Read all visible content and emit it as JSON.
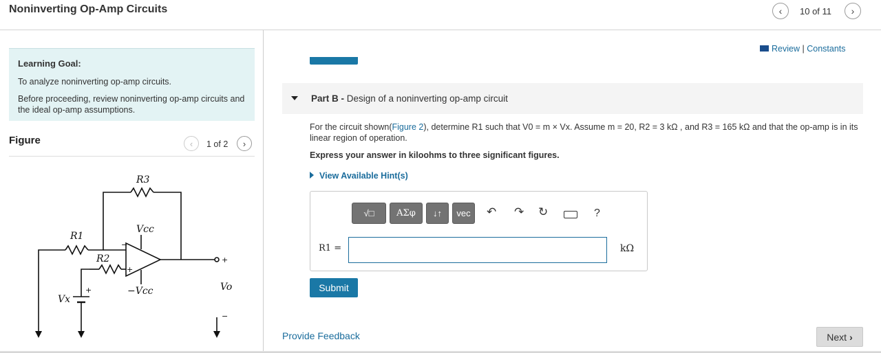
{
  "header": {
    "title": "Noninverting Op-Amp Circuits",
    "page_counter": "10 of 11"
  },
  "learning_goal": {
    "title": "Learning Goal:",
    "line1": "To analyze noninverting op-amp circuits.",
    "line2": "Before proceeding, review noninverting op-amp circuits and the ideal op-amp assumptions."
  },
  "figure": {
    "title": "Figure",
    "pager": "1 of 2",
    "labels": {
      "r3": "R3",
      "r1": "R1",
      "r2": "R2",
      "vcc": "Vcc",
      "neg_vcc": "−Vcc",
      "vo": "Vo",
      "vx": "Vx",
      "plus": "+",
      "minus": "−"
    }
  },
  "review": {
    "review_label": "Review",
    "separator": "|",
    "constants_label": "Constants"
  },
  "part_b": {
    "label": "Part B - ",
    "title": "Design of a noninverting op-amp circuit",
    "q_prefix": "For the circuit shown(",
    "figure_link": "Figure 2",
    "q_suffix": "), determine R1 such that V0 = m × Vx. Assume m = 20, R2 = 3 kΩ , and R3 = 165 kΩ and that the op-amp is in its linear region of operation.",
    "express": "Express your answer in kiloohms to three significant figures.",
    "hint": "View Available Hint(s)"
  },
  "toolbar": {
    "template_label": "√□",
    "symbols_label": "ΑΣφ",
    "arrows_label": "↓↑",
    "vec_label": "vec",
    "help_label": "?"
  },
  "answer": {
    "var_label": "R1 =",
    "unit": "kΩ",
    "value": ""
  },
  "buttons": {
    "submit": "Submit",
    "next": "Next",
    "provide_feedback": "Provide Feedback"
  }
}
